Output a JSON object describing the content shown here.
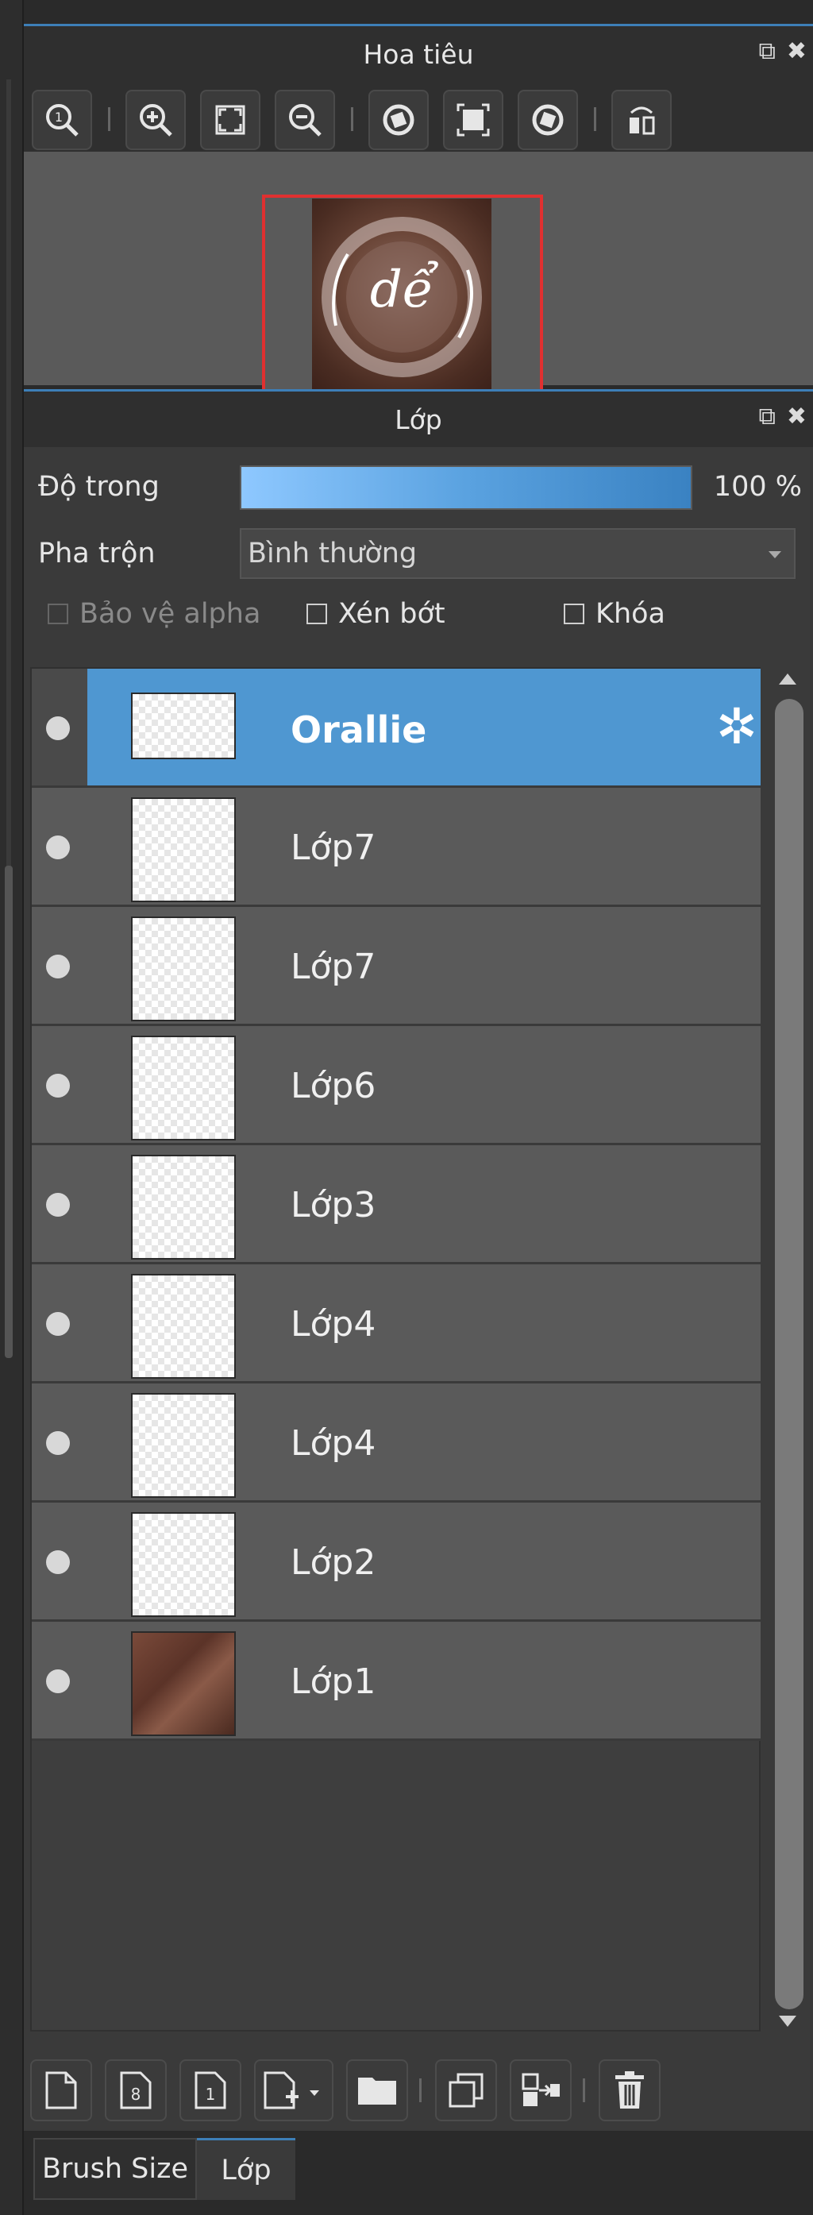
{
  "navigator": {
    "title": "Hoa tiêu",
    "thumbnail_text": "dể"
  },
  "layers_panel": {
    "title": "Lớp",
    "opacity_label": "Độ trong",
    "opacity_value": "100 %",
    "opacity_level": 1.0,
    "blend_label": "Pha trộn",
    "blend_value": "Bình thường",
    "protect_alpha_label": "Bảo vệ alpha",
    "clip_label": "Xén bớt",
    "lock_label": "Khóa",
    "layers": [
      {
        "name": "Orallie",
        "selected": true
      },
      {
        "name": "Lớp7"
      },
      {
        "name": "Lớp7"
      },
      {
        "name": "Lớp6"
      },
      {
        "name": "Lớp3"
      },
      {
        "name": "Lớp4"
      },
      {
        "name": "Lớp4"
      },
      {
        "name": "Lớp2"
      },
      {
        "name": "Lớp1"
      }
    ]
  },
  "tabs": {
    "brush_size": "Brush Size",
    "layer": "Lớp"
  },
  "colors": {
    "accent": "#4f97d1",
    "nav_frame": "#e03030"
  }
}
